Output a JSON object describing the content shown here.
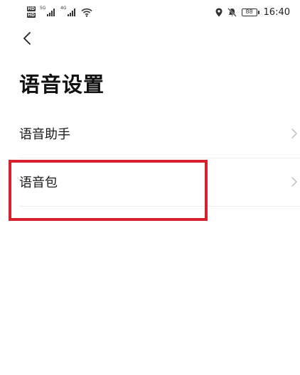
{
  "status_bar": {
    "sim1": "HD",
    "sim2": "HD",
    "net1": "5G",
    "net2": "4G",
    "battery": "88",
    "time": "16:40"
  },
  "page": {
    "title": "语音设置"
  },
  "list": {
    "items": [
      {
        "label": "语音助手"
      },
      {
        "label": "语音包"
      }
    ]
  },
  "colors": {
    "highlight": "#d6212a",
    "divider": "#ececec",
    "text": "#1a1a1a"
  }
}
